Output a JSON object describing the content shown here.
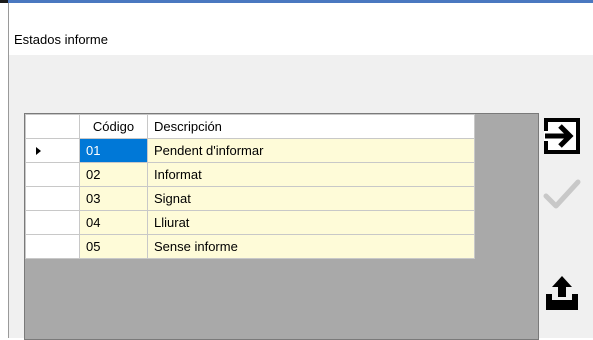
{
  "window": {
    "title": "Estados informe"
  },
  "grid": {
    "columns": [
      "",
      "Código",
      "Descripción"
    ],
    "rows": [
      {
        "code": "01",
        "description": "Pendent d'informar",
        "current": true
      },
      {
        "code": "02",
        "description": "Informat",
        "current": false
      },
      {
        "code": "03",
        "description": "Signat",
        "current": false
      },
      {
        "code": "04",
        "description": "Lliurat",
        "current": false
      },
      {
        "code": "05",
        "description": "Sense informe",
        "current": false
      }
    ]
  },
  "toolbar": [
    {
      "icon": "exit-icon",
      "enabled": true
    },
    {
      "icon": "checkmark-icon",
      "enabled": false
    },
    {
      "icon": "export-tray-icon",
      "enabled": true
    }
  ],
  "colors": {
    "selected_cell": "#0078d7",
    "row_background": "#fefbd8",
    "grid_backdrop": "#a9a9a9",
    "window_accent": "#4a78c0"
  }
}
